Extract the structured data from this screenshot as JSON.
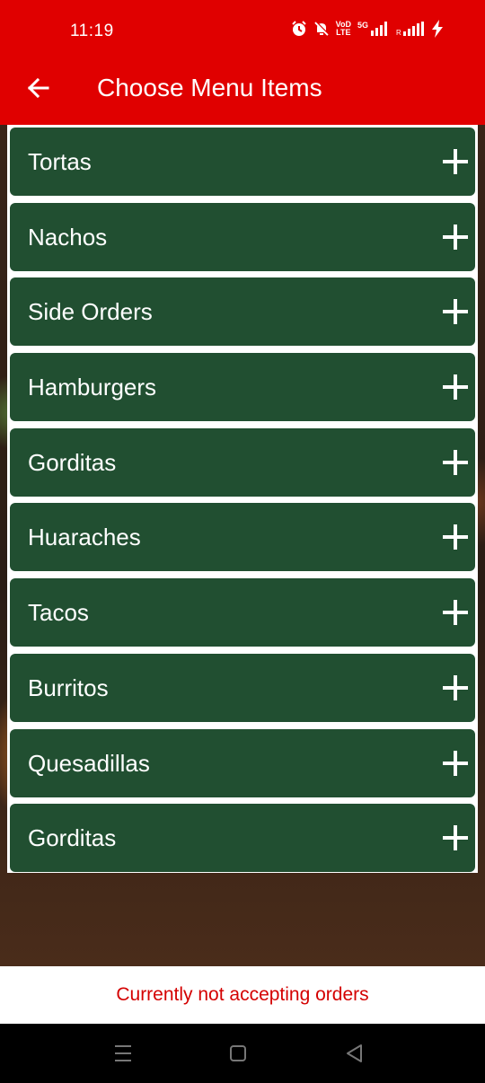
{
  "status_bar": {
    "time": "11:19",
    "network_label_top": "VoD",
    "network_label_bottom": "LTE",
    "signal_label": "5G"
  },
  "header": {
    "back_icon": "arrow-left-icon",
    "title": "Choose Menu Items"
  },
  "menu": {
    "expand_icon": "plus-icon",
    "items": [
      {
        "label": "Tortas"
      },
      {
        "label": "Nachos"
      },
      {
        "label": "Side Orders"
      },
      {
        "label": "Hamburgers"
      },
      {
        "label": "Gorditas"
      },
      {
        "label": "Huaraches"
      },
      {
        "label": "Tacos"
      },
      {
        "label": "Burritos"
      },
      {
        "label": "Quesadillas"
      },
      {
        "label": "Gorditas"
      }
    ]
  },
  "footer": {
    "status_message": "Currently not accepting orders"
  },
  "system_nav": {
    "buttons": [
      "menu-lines-icon",
      "home-square-icon",
      "back-triangle-icon"
    ]
  },
  "colors": {
    "app_bar": "#e00000",
    "menu_item": "#214f31",
    "banner_text": "#d40000"
  }
}
